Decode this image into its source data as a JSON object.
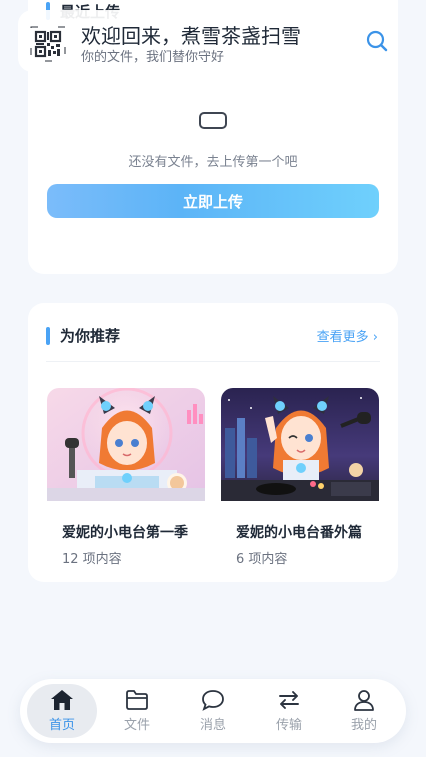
{
  "header": {
    "title": "欢迎回来，煮雪茶盏扫雪",
    "subtitle": "你的文件，我们替你守好"
  },
  "recent": {
    "title": "最近上传",
    "empty_text": "还没有文件，去上传第一个吧",
    "upload_label": "立即上传"
  },
  "recommend": {
    "title": "为你推荐",
    "see_more": "查看更多",
    "items": [
      {
        "name": "爱妮的小电台第一季",
        "count": "12 项内容"
      },
      {
        "name": "爱妮的小电台番外篇",
        "count": "6 项内容"
      }
    ]
  },
  "tabbar": {
    "items": [
      {
        "label": "首页",
        "icon": "home-icon",
        "active": true
      },
      {
        "label": "文件",
        "icon": "folder-icon",
        "active": false
      },
      {
        "label": "消息",
        "icon": "message-icon",
        "active": false
      },
      {
        "label": "传输",
        "icon": "transfer-icon",
        "active": false
      },
      {
        "label": "我的",
        "icon": "user-icon",
        "active": false
      }
    ]
  },
  "colors": {
    "accent": "#4aa3f5",
    "tab_active": "#3b93e8",
    "background": "#f4f7fc"
  }
}
